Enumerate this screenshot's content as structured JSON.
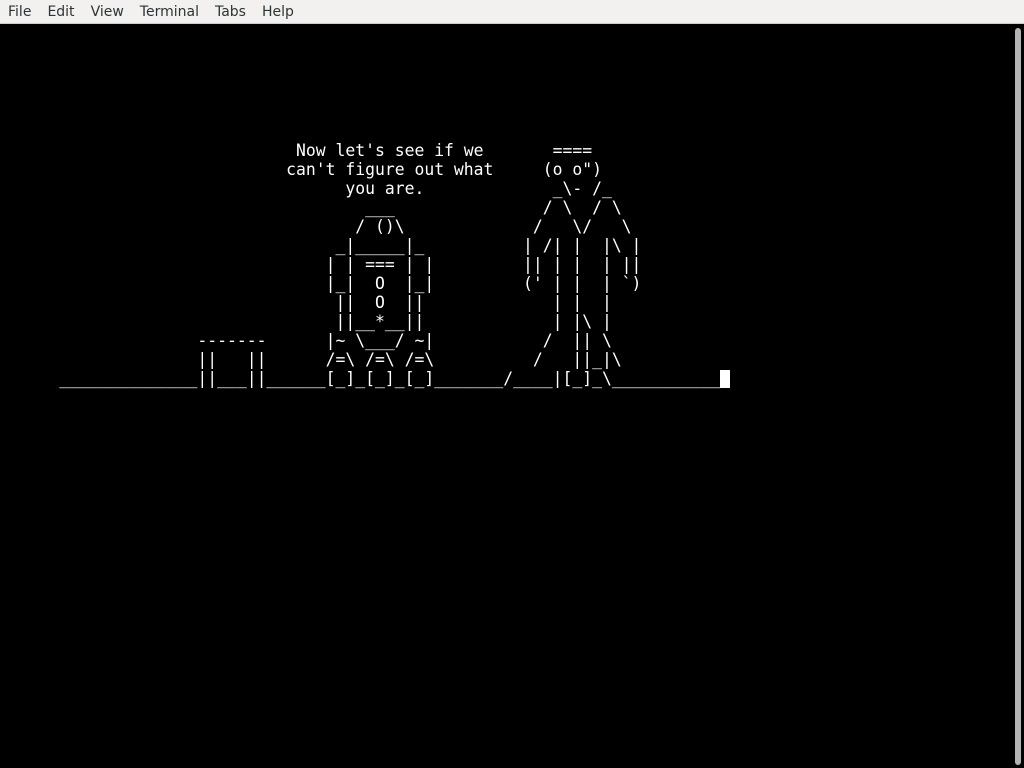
{
  "menu": [
    "File",
    "Edit",
    "View",
    "Terminal",
    "Tabs",
    "Help"
  ],
  "terminal": {
    "lines": [
      "                              Now let's see if we       ====",
      "                             can't figure out what     (o o\")",
      "                                   you are.             _\\- /_",
      "                                     ___               / \\  / \\",
      "                                    / ()\\             /   \\/   \\",
      "                                  _|_____|_          | /| |  |\\ |",
      "                                 | | === | |         || | |  | ||",
      "                                 |_|  O  |_|         (' | |  | `)",
      "                                  ||  O  ||             | |  |",
      "                                  ||__*__||             | |\\ |",
      "                    -------      |~ \\___/ ~|           /  || \\",
      "                    ||   ||      /=\\ /=\\ /=\\          /   ||_|\\",
      "      ______________||___||______[_]_[_]_[_]_______/____|[_]_\\___________"
    ]
  }
}
